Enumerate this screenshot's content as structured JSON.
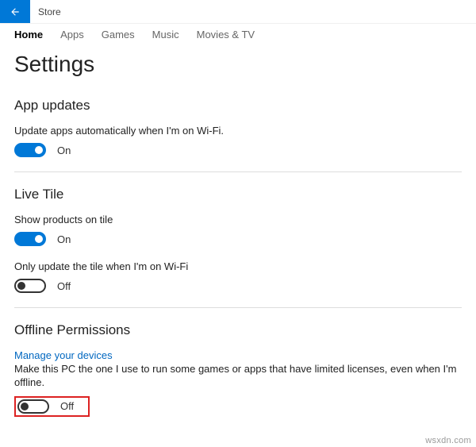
{
  "titlebar": {
    "app_name": "Store"
  },
  "tabs": [
    {
      "label": "Home",
      "active": true
    },
    {
      "label": "Apps",
      "active": false
    },
    {
      "label": "Games",
      "active": false
    },
    {
      "label": "Music",
      "active": false
    },
    {
      "label": "Movies & TV",
      "active": false
    }
  ],
  "page_title": "Settings",
  "sections": {
    "app_updates": {
      "title": "App updates",
      "auto_update": {
        "label": "Update apps automatically when I'm on Wi-Fi.",
        "state": "On",
        "on": true
      }
    },
    "live_tile": {
      "title": "Live Tile",
      "show_products": {
        "label": "Show products on tile",
        "state": "On",
        "on": true
      },
      "wifi_only": {
        "label": "Only update the tile when I'm on Wi-Fi",
        "state": "Off",
        "on": false
      }
    },
    "offline": {
      "title": "Offline Permissions",
      "manage_link": "Manage your devices",
      "desc": "Make this PC the one I use to run some games or apps that have limited licenses, even when I'm offline.",
      "toggle": {
        "state": "Off",
        "on": false
      }
    }
  },
  "watermark": "wsxdn.com"
}
